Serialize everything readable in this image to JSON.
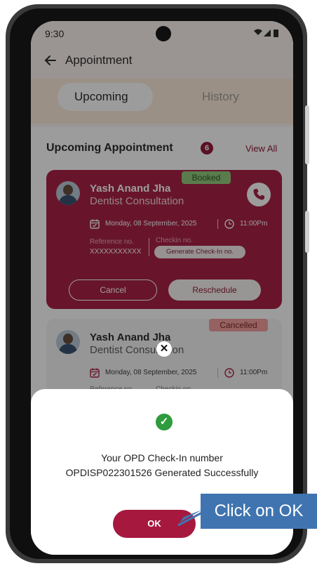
{
  "status_bar": {
    "time": "9:30"
  },
  "header": {
    "title": "Appointment"
  },
  "tabs": [
    {
      "label": "Upcoming",
      "active": true
    },
    {
      "label": "History",
      "active": false
    }
  ],
  "section": {
    "title": "Upcoming Appointment",
    "count": "6",
    "view_all": "View All"
  },
  "appointments": [
    {
      "status": "Booked",
      "doctor": "Yash Anand Jha",
      "specialty": "Dentist Consultation",
      "date": "Monday, 08 September, 2025",
      "time": "11:00Pm",
      "reference_label": "Reference no.",
      "reference_value": "XXXXXXXXXXX",
      "checkin_label": "Checkin no.",
      "generate_label": "Generate Check-In no.",
      "cancel_label": "Cancel",
      "reschedule_label": "Reschedule"
    },
    {
      "status": "Cancelled",
      "doctor": "Yash Anand Jha",
      "specialty": "Dentist Consultation",
      "date": "Monday, 08 September, 2025",
      "time": "11:00Pm",
      "reference_label": "Reference no.",
      "checkin_label": "Checkin no."
    }
  ],
  "dialog": {
    "message_line1": "Your OPD Check-In number",
    "message_line2": "OPDISP022301526 Generated Successfully",
    "ok_label": "OK"
  },
  "annotation": {
    "callout_text": "Click on OK"
  },
  "colors": {
    "brand": "#a6183e",
    "success": "#2e9b3c",
    "callout": "#3f74b0"
  }
}
